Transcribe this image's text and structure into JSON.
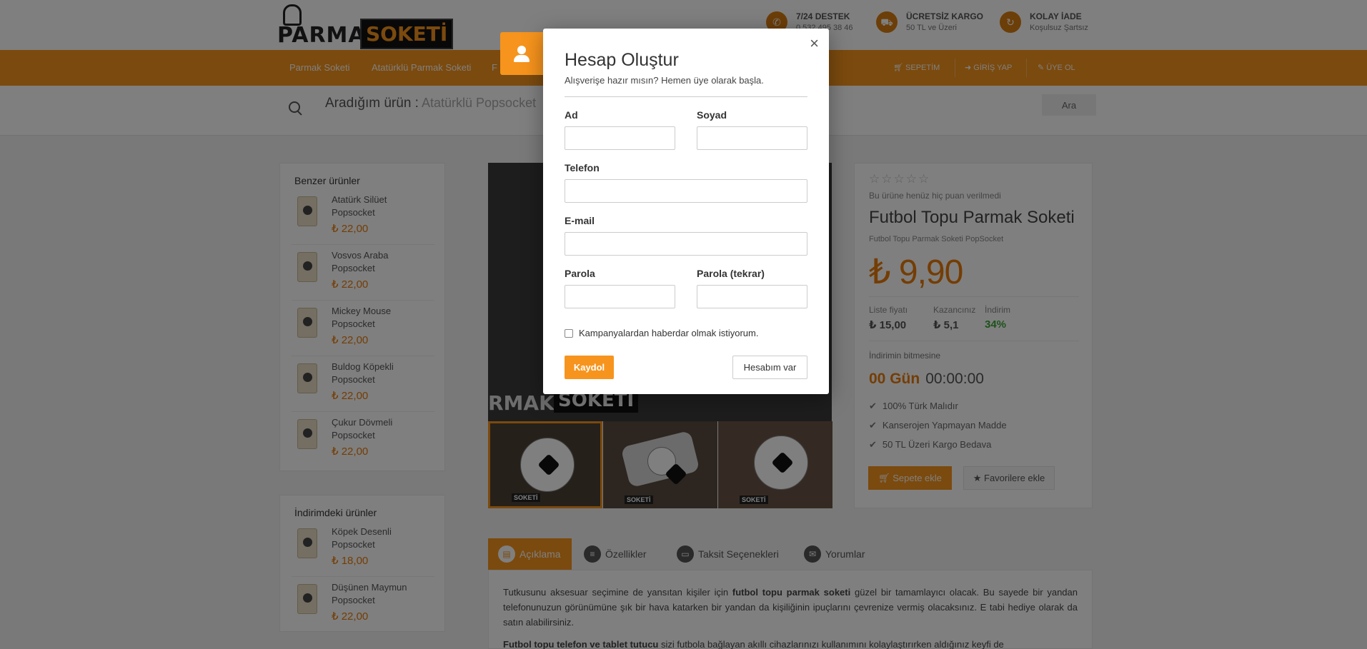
{
  "brand": {
    "part1": "PARMAK",
    "part2": "SOKETİ"
  },
  "features": [
    {
      "title": "7/24 DESTEK",
      "sub": "0 532 495 38 46",
      "icon": "phone-icon"
    },
    {
      "title": "ÜCRETSİZ KARGO",
      "sub": "50 TL ve Üzeri",
      "icon": "truck-icon"
    },
    {
      "title": "KOLAY İADE",
      "sub": "Koşulsuz Şartsız",
      "icon": "refresh-icon"
    }
  ],
  "nav": {
    "items": [
      "Parmak Soketi",
      "Atatürklü Parmak Soketi",
      "F"
    ],
    "right": [
      "SEPETİM",
      "GİRİŞ YAP",
      "ÜYE OL"
    ]
  },
  "search": {
    "label": "Aradığım ürün :",
    "placeholder": "Atatürklü Popsocket",
    "button": "Ara"
  },
  "similar": {
    "heading": "Benzer ürünler",
    "items": [
      {
        "name": "Atatürk Silüet Popsocket",
        "price": "₺ 22,00"
      },
      {
        "name": "Vosvos Araba Popsocket",
        "price": "₺ 22,00"
      },
      {
        "name": "Mickey Mouse Popsocket",
        "price": "₺ 22,00"
      },
      {
        "name": "Buldog Köpekli Popsocket",
        "price": "₺ 22,00"
      },
      {
        "name": "Çukur Dövmeli Popsocket",
        "price": "₺ 22,00"
      }
    ]
  },
  "discounted": {
    "heading": "İndirimdeki ürünler",
    "items": [
      {
        "name": "Köpek Desenli Popsocket",
        "price": "₺ 18,00"
      },
      {
        "name": "Düşünen Maymun Popsocket",
        "price": "₺ 22,00"
      }
    ]
  },
  "gallery": {
    "watermark1": "RMAK",
    "watermark2": "SOKETİ",
    "thumb_label": "SOKETİ"
  },
  "product": {
    "stars": "☆☆☆☆☆",
    "no_rating": "Bu ürüne henüz hiç puan verilmedi",
    "title": "Futbol Topu Parmak Soketi",
    "subtitle": "Futbol Topu Parmak Soketi PopSocket",
    "price": "₺ 9,90",
    "list_label": "Liste fiyatı",
    "list_value": "₺ 15,00",
    "gain_label": "Kazancınız",
    "gain_value": "₺ 5,1",
    "discount_label": "İndirim",
    "discount_value": "34%",
    "countdown_label": "İndirimin bitmesine",
    "countdown_days": "00 Gün",
    "countdown_time": "00:00:00",
    "features": [
      "100% Türk Malıdır",
      "Kanserojen Yapmayan Madde",
      "50 TL Üzeri Kargo Bedava"
    ],
    "add_to_cart": "Sepete ekle",
    "add_to_fav": "Favorilere ekle"
  },
  "tabs": [
    "Açıklama",
    "Özellikler",
    "Taksit Seçenekleri",
    "Yorumlar"
  ],
  "description": {
    "p1_a": "Tutkusunu aksesuar seçimine de yansıtan kişiler için ",
    "p1_b": "futbol topu parmak soketi",
    "p1_c": " güzel bir tamamlayıcı olacak. Bu sayede bir yandan telefonunuzun görünümüne şık bir hava katarken bir yandan da kişiliğinin ipuçlarını çevrenize vermiş olacaksınız. E tabi hediye olarak da satın alabilirsiniz.",
    "p2_a": "Futbol topu telefon ve tablet tutucu",
    "p2_b": " sizi futbola bağlayan akıllı cihazlarınızı kullanımını kolaylaştırırken aldığınız keyfi de"
  },
  "modal": {
    "title": "Hesap Oluştur",
    "subtitle": "Alışverişe hazır mısın? Hemen üye olarak başla.",
    "close": "×",
    "labels": {
      "first_name": "Ad",
      "last_name": "Soyad",
      "phone": "Telefon",
      "email": "E-mail",
      "password": "Parola",
      "password_repeat": "Parola (tekrar)"
    },
    "values": {
      "first_name": "",
      "last_name": "",
      "phone": "",
      "email": "",
      "password": "",
      "password_repeat": ""
    },
    "newsletter": "Kampanyalardan haberdar olmak istiyorum.",
    "submit": "Kaydol",
    "have_account": "Hesabım var"
  },
  "colors": {
    "accent": "#f7941d",
    "price": "#e87b08",
    "green": "#3aa538"
  }
}
